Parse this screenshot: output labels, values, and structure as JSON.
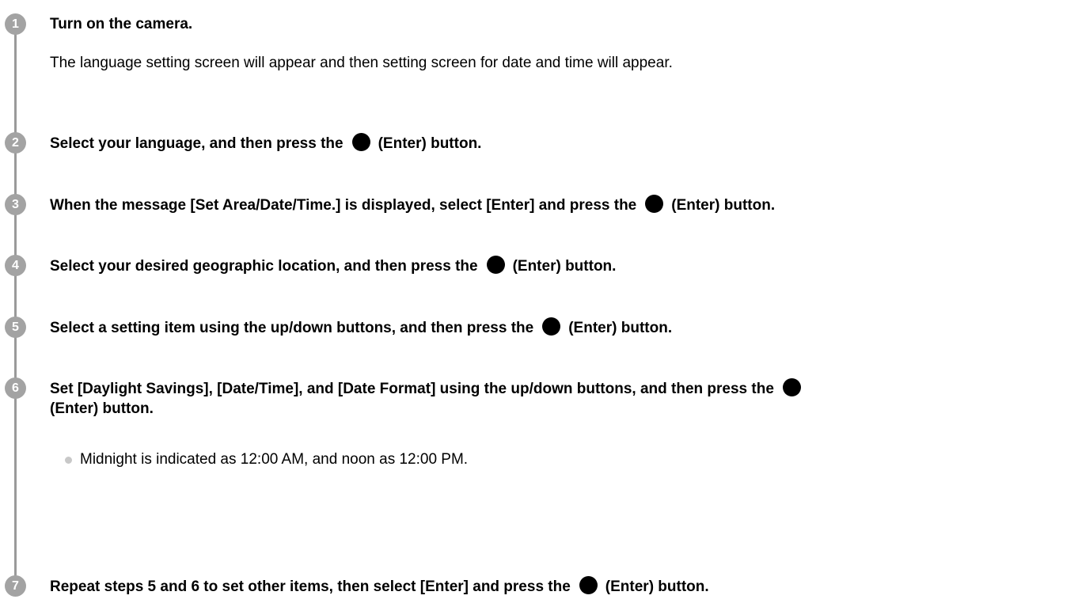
{
  "steps": [
    {
      "number": "1",
      "title": "Turn on the camera.",
      "description": "The language setting screen will appear and then setting screen for date and time will appear."
    },
    {
      "number": "2",
      "title_before": "Select your language, and then press the",
      "title_after": "(Enter) button."
    },
    {
      "number": "3",
      "title_before": "When the message [Set Area/Date/Time.] is displayed, select [Enter] and press the",
      "title_after": "(Enter) button."
    },
    {
      "number": "4",
      "title_before": "Select your desired geographic location, and then press the",
      "title_after": "(Enter) button."
    },
    {
      "number": "5",
      "title_before": "Select a setting item using the up/down buttons, and then press the",
      "title_after": "(Enter) button."
    },
    {
      "number": "6",
      "title_before": "Set [Daylight Savings], [Date/Time], and [Date Format] using the up/down buttons, and then press the",
      "title_after": "(Enter) button.",
      "note": "Midnight is indicated as 12:00 AM, and noon as 12:00 PM."
    },
    {
      "number": "7",
      "title_before": "Repeat steps 5 and 6 to set other items, then select [Enter] and press the",
      "title_after": "(Enter) button."
    }
  ],
  "icons": {
    "enter": "enter-button-icon"
  },
  "colors": {
    "step_badge": "#a3a3a3",
    "timeline": "#9a9a9a",
    "bullet": "#c8c8c8"
  }
}
